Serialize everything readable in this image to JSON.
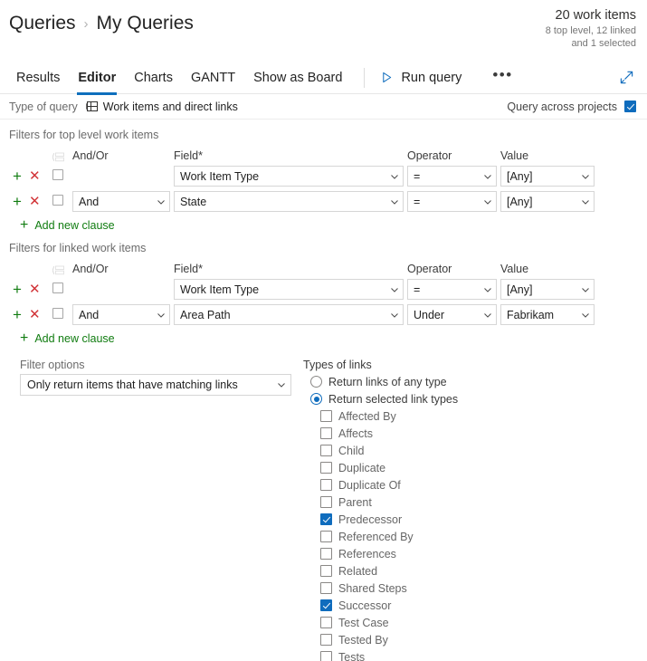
{
  "header": {
    "breadcrumb_root": "Queries",
    "breadcrumb_sep": "›",
    "breadcrumb_leaf": "My Queries",
    "count_main": "20 work items",
    "count_sub_line1": "8 top level, 12 linked",
    "count_sub_line2": "and 1 selected"
  },
  "tabs": [
    {
      "label": "Results",
      "active": false
    },
    {
      "label": "Editor",
      "active": true
    },
    {
      "label": "Charts",
      "active": false
    },
    {
      "label": "GANTT",
      "active": false
    },
    {
      "label": "Show as Board",
      "active": false
    }
  ],
  "toolbar": {
    "run_query_label": "Run query",
    "more_label": "•••"
  },
  "query_type": {
    "label": "Type of query",
    "value": "Work items and direct links",
    "across_projects_label": "Query across projects",
    "across_projects_checked": true
  },
  "columns": {
    "and_or": "And/Or",
    "field": "Field*",
    "operator": "Operator",
    "value": "Value"
  },
  "top_level": {
    "section_title": "Filters for top level work items",
    "clauses": [
      {
        "and_or": "",
        "field": "Work Item Type",
        "operator": "=",
        "value": "[Any]",
        "checked": false
      },
      {
        "and_or": "And",
        "field": "State",
        "operator": "=",
        "value": "[Any]",
        "checked": false
      }
    ],
    "add_clause_label": "Add new clause"
  },
  "linked": {
    "section_title": "Filters for linked work items",
    "clauses": [
      {
        "and_or": "",
        "field": "Work Item Type",
        "operator": "=",
        "value": "[Any]",
        "checked": false
      },
      {
        "and_or": "And",
        "field": "Area Path",
        "operator": "Under",
        "value": "Fabrikam",
        "checked": false
      }
    ],
    "add_clause_label": "Add new clause"
  },
  "filter_options": {
    "label": "Filter options",
    "value": "Only return items that have matching links"
  },
  "types_of_links": {
    "label": "Types of links",
    "radios": [
      {
        "label": "Return links of any type",
        "selected": false
      },
      {
        "label": "Return selected link types",
        "selected": true
      }
    ],
    "link_types": [
      {
        "label": "Affected By",
        "checked": false
      },
      {
        "label": "Affects",
        "checked": false
      },
      {
        "label": "Child",
        "checked": false
      },
      {
        "label": "Duplicate",
        "checked": false
      },
      {
        "label": "Duplicate Of",
        "checked": false
      },
      {
        "label": "Parent",
        "checked": false
      },
      {
        "label": "Predecessor",
        "checked": true
      },
      {
        "label": "Referenced By",
        "checked": false
      },
      {
        "label": "References",
        "checked": false
      },
      {
        "label": "Related",
        "checked": false
      },
      {
        "label": "Shared Steps",
        "checked": false
      },
      {
        "label": "Successor",
        "checked": true
      },
      {
        "label": "Test Case",
        "checked": false
      },
      {
        "label": "Tested By",
        "checked": false
      },
      {
        "label": "Tests",
        "checked": false
      }
    ]
  },
  "colors": {
    "accent": "#0f6cbd",
    "add_green": "#107c10",
    "remove_red": "#d13438",
    "muted_text": "#6b6b6b"
  }
}
